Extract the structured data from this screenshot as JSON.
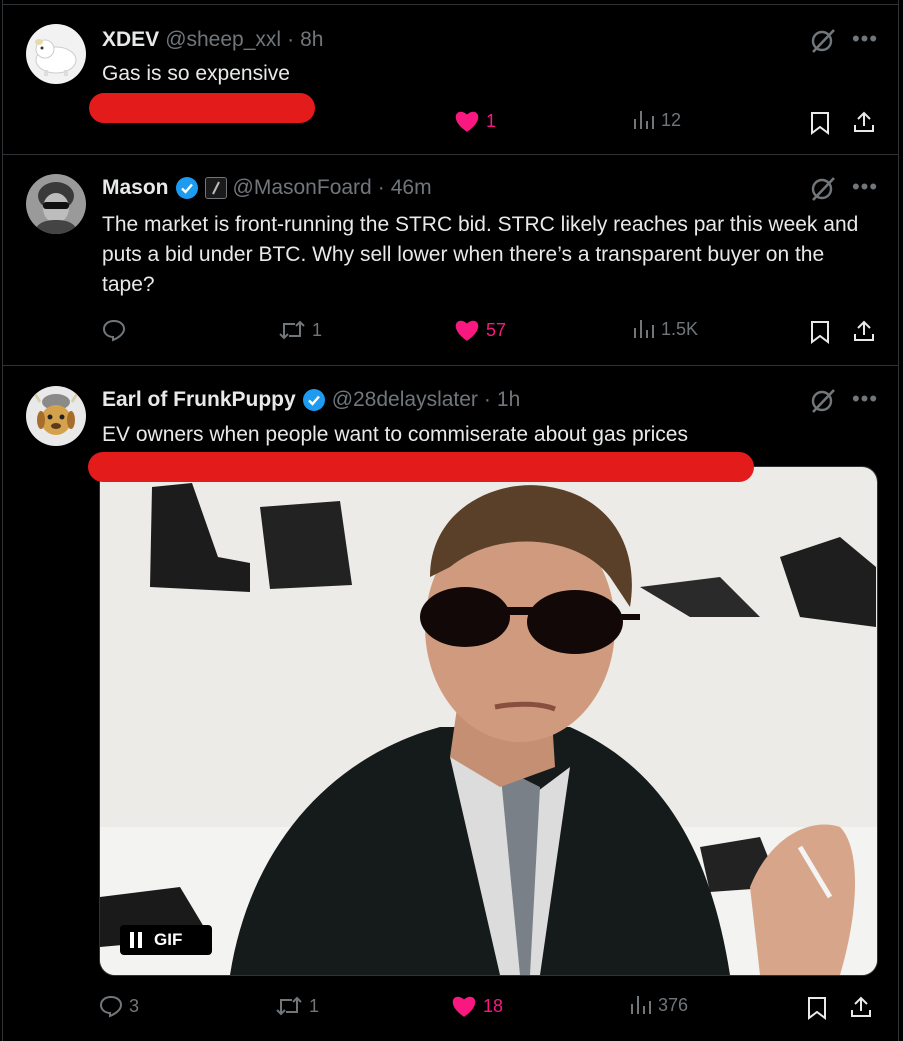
{
  "posts": [
    {
      "name": "XDEV",
      "handle": "@sheep_xxl",
      "separator": "·",
      "time": "8h",
      "text": "Gas is so expensive",
      "likes": "1",
      "views": "12"
    },
    {
      "name": "Mason",
      "handle": "@MasonFoard",
      "separator": "·",
      "time": "46m",
      "text": "The market is front-running the STRC bid. STRC likely reaches par this week and puts a bid under BTC. Why sell lower when there’s a transparent buyer on the tape?",
      "reposts": "1",
      "likes": "57",
      "views": "1.5K"
    },
    {
      "name": "Earl of FrunkPuppy",
      "handle": "@28delayslater",
      "separator": "·",
      "time": "1h",
      "text": "EV owners when people want to commiserate about gas prices",
      "gif_label": "GIF",
      "replies": "3",
      "reposts": "1",
      "likes": "18",
      "views": "376"
    }
  ],
  "colors": {
    "background": "#000000",
    "text": "#e7e9ea",
    "secondary": "#71767b",
    "like": "#f91880",
    "verified": "#1d9bf0",
    "redaction": "#e31b1b"
  }
}
